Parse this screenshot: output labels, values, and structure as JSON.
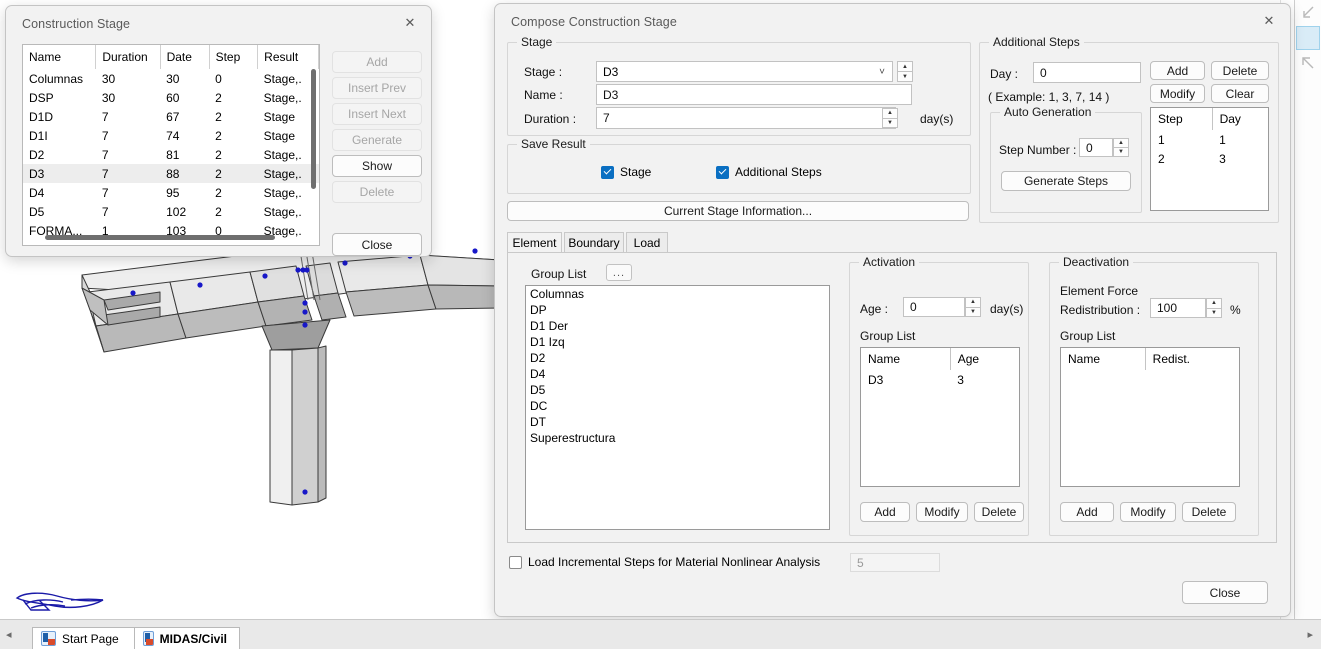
{
  "construction_stage_dialog": {
    "title": "Construction Stage",
    "close_icon": "close-icon",
    "table": {
      "headers": [
        "Name",
        "Duration",
        "Date",
        "Step",
        "Result"
      ],
      "rows": [
        {
          "name": "Columnas",
          "duration": "30",
          "date": "30",
          "step": "0",
          "result": "Stage,.",
          "selected": false
        },
        {
          "name": "DSP",
          "duration": "30",
          "date": "60",
          "step": "2",
          "result": "Stage,.",
          "selected": false
        },
        {
          "name": "D1D",
          "duration": "7",
          "date": "67",
          "step": "2",
          "result": "Stage",
          "selected": false
        },
        {
          "name": "D1I",
          "duration": "7",
          "date": "74",
          "step": "2",
          "result": "Stage",
          "selected": false
        },
        {
          "name": "D2",
          "duration": "7",
          "date": "81",
          "step": "2",
          "result": "Stage,.",
          "selected": false
        },
        {
          "name": "D3",
          "duration": "7",
          "date": "88",
          "step": "2",
          "result": "Stage,.",
          "selected": true
        },
        {
          "name": "D4",
          "duration": "7",
          "date": "95",
          "step": "2",
          "result": "Stage,.",
          "selected": false
        },
        {
          "name": "D5",
          "duration": "7",
          "date": "102",
          "step": "2",
          "result": "Stage,.",
          "selected": false
        },
        {
          "name": "FORMA...",
          "duration": "1",
          "date": "103",
          "step": "0",
          "result": "Stage,.",
          "selected": false
        }
      ]
    },
    "buttons": [
      {
        "label": "Add",
        "enabled": false
      },
      {
        "label": "Insert Prev",
        "enabled": false
      },
      {
        "label": "Insert Next",
        "enabled": false
      },
      {
        "label": "Generate",
        "enabled": false
      },
      {
        "label": "Show",
        "enabled": true
      },
      {
        "label": "Delete",
        "enabled": false
      }
    ],
    "close_button": "Close"
  },
  "compose_dialog": {
    "title": "Compose Construction Stage",
    "close_icon": "close-icon",
    "stage_group": {
      "legend": "Stage",
      "stage_label": "Stage :",
      "stage_value": "D3",
      "name_label": "Name :",
      "name_value": "D3",
      "duration_label": "Duration :",
      "duration_value": "7",
      "duration_unit": "day(s)"
    },
    "save_result_group": {
      "legend": "Save Result",
      "stage_checkbox": {
        "label": "Stage",
        "checked": true
      },
      "additional_steps_checkbox": {
        "label": "Additional Steps",
        "checked": true
      }
    },
    "current_stage_information_button": "Current Stage Information...",
    "additional_steps_group": {
      "legend": "Additional Steps",
      "day_label": "Day :",
      "day_value": "0",
      "example_text": "( Example: 1, 3, 7, 14  )",
      "buttons": [
        "Add",
        "Delete",
        "Modify",
        "Clear"
      ],
      "auto_generation": {
        "legend": "Auto Generation",
        "step_number_label": "Step Number  :",
        "step_number_value": "0",
        "generate_steps_button": "Generate Steps"
      },
      "table": {
        "headers": [
          "Step",
          "Day"
        ],
        "rows": [
          {
            "step": "1",
            "day": "1"
          },
          {
            "step": "2",
            "day": "3"
          }
        ]
      }
    },
    "tabs": [
      {
        "label": "Element",
        "active": true
      },
      {
        "label": "Boundary",
        "active": false
      },
      {
        "label": "Load",
        "active": false
      }
    ],
    "element_tab": {
      "group_list_label": "Group List",
      "browse_button": "...",
      "group_list_items": [
        "Columnas",
        "DP",
        "D1 Der",
        "D1 Izq",
        "D2",
        "D4",
        "D5",
        "DC",
        "DT",
        "Superestructura"
      ],
      "activation": {
        "legend": "Activation",
        "age_label": "Age  :",
        "age_value": "0",
        "age_unit": "day(s)",
        "group_list_label": "Group List",
        "table": {
          "headers": [
            "Name",
            "Age"
          ],
          "rows": [
            {
              "name": "D3",
              "age": "3"
            }
          ]
        },
        "buttons": [
          "Add",
          "Modify",
          "Delete"
        ]
      },
      "deactivation": {
        "legend": "Deactivation",
        "element_force_label": "Element Force",
        "redistribution_label": "Redistribution :",
        "redistribution_value": "100",
        "redistribution_unit": "%",
        "group_list_label": "Group List",
        "table": {
          "headers": [
            "Name",
            "Redist."
          ],
          "rows": []
        },
        "buttons": [
          "Add",
          "Modify",
          "Delete"
        ]
      }
    },
    "load_incremental_checkbox": {
      "label": "Load Incremental Steps for Material Nonlinear Analysis",
      "checked": false
    },
    "load_incremental_value": "5",
    "close_button": "Close"
  },
  "right_toolbar": {
    "items": [
      {
        "icon": "arrow-down-left-icon",
        "selected": false
      },
      {
        "icon": "square-select-icon",
        "selected": true
      },
      {
        "icon": "arrow-up-left-icon",
        "selected": false
      }
    ]
  },
  "taskbar": {
    "left_arrow_icon": "triangle-left-icon",
    "right_arrow_icon": "triangle-right-icon",
    "tabs": [
      {
        "label": "Start Page",
        "icon": "midas-app-icon",
        "active": false
      },
      {
        "label": "MIDAS/Civil",
        "icon": "midas-app-icon",
        "active": true
      }
    ]
  },
  "colors": {
    "dialog_bg": "#f2f2f2",
    "accent_checkbox": "#0a6fc2",
    "selection_row": "#ededed",
    "model_node": "#1818c8",
    "rail_selected": "#d9ecf7"
  }
}
